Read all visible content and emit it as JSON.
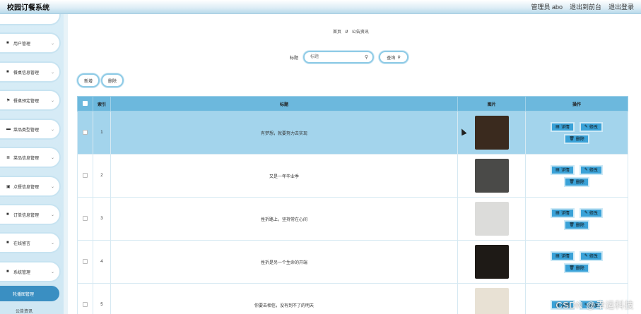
{
  "app": {
    "title": "校园订餐系统"
  },
  "topbar": {
    "user": "管理员 abo",
    "front": "退出到前台",
    "logout": "退出登录"
  },
  "sidebar": {
    "items": [
      {
        "label": "用户管理",
        "icon": "grid-icon"
      },
      {
        "label": "餐桌信息管理",
        "icon": "grid-icon"
      },
      {
        "label": "餐桌预定管理",
        "icon": "flag-icon"
      },
      {
        "label": "菜品类型管理",
        "icon": "monitor-icon"
      },
      {
        "label": "菜品信息管理",
        "icon": "doc-icon"
      },
      {
        "label": "点餐信息管理",
        "icon": "calendar-icon"
      },
      {
        "label": "订单信息管理",
        "icon": "grid-icon"
      },
      {
        "label": "在线留言",
        "icon": "grid-icon"
      },
      {
        "label": "系统管理",
        "icon": "grid-icon"
      }
    ],
    "sub_active": "轮播图管理",
    "sub_next": "公告资讯"
  },
  "breadcrumb": {
    "home": "首页",
    "sep": "//",
    "current": "公告资讯"
  },
  "search": {
    "label": "标题",
    "placeholder": "标题",
    "button": "查询"
  },
  "actions": {
    "add": "新增",
    "delete": "删除"
  },
  "table": {
    "headers": {
      "index": "索引",
      "title": "标题",
      "image": "图片",
      "ops": "操作"
    },
    "ops_labels": {
      "detail": "详情",
      "edit": "修改",
      "delete": "删除"
    },
    "rows": [
      {
        "index": "1",
        "title": "有梦想，就要努力去实现",
        "thumb_color": "#3a2a1e"
      },
      {
        "index": "2",
        "title": "又是一年毕业季",
        "thumb_color": "#4a4a48"
      },
      {
        "index": "3",
        "title": "挫折路上，坚持常在心间",
        "thumb_color": "#dcdcda"
      },
      {
        "index": "4",
        "title": "挫折是另一个生命的开端",
        "thumb_color": "#1e1a16"
      },
      {
        "index": "5",
        "title": "你要去相信，没有到不了的明天",
        "thumb_color": "#e8e1d4"
      }
    ]
  },
  "watermark": "CSDN @幸运科技"
}
